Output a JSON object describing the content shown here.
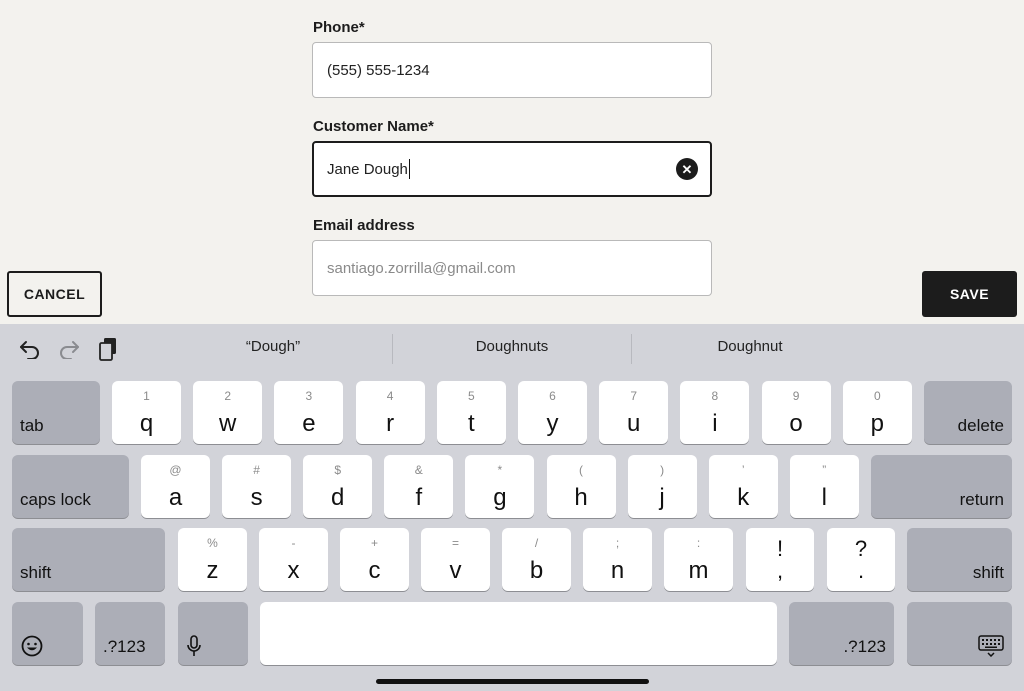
{
  "form": {
    "phone_label": "Phone*",
    "phone_value": "(555) 555-1234",
    "name_label": "Customer Name*",
    "name_value": "Jane Dough",
    "email_label": "Email address",
    "email_placeholder": "santiago.zorrilla@gmail.com"
  },
  "actions": {
    "cancel": "CANCEL",
    "save": "SAVE"
  },
  "keyboard": {
    "suggestions": [
      "“Dough”",
      "Doughnuts",
      "Doughnut"
    ],
    "toolbar_icons": [
      "undo-icon",
      "redo-icon",
      "clipboard-icon"
    ],
    "row1": [
      {
        "main": "q",
        "alt": "1"
      },
      {
        "main": "w",
        "alt": "2"
      },
      {
        "main": "e",
        "alt": "3"
      },
      {
        "main": "r",
        "alt": "4"
      },
      {
        "main": "t",
        "alt": "5"
      },
      {
        "main": "y",
        "alt": "6"
      },
      {
        "main": "u",
        "alt": "7"
      },
      {
        "main": "i",
        "alt": "8"
      },
      {
        "main": "o",
        "alt": "9"
      },
      {
        "main": "p",
        "alt": "0"
      }
    ],
    "row2": [
      {
        "main": "a",
        "alt": "@"
      },
      {
        "main": "s",
        "alt": "#"
      },
      {
        "main": "d",
        "alt": "$"
      },
      {
        "main": "f",
        "alt": "&"
      },
      {
        "main": "g",
        "alt": "*"
      },
      {
        "main": "h",
        "alt": "("
      },
      {
        "main": "j",
        "alt": ")"
      },
      {
        "main": "k",
        "alt": "’"
      },
      {
        "main": "l",
        "alt": "”"
      }
    ],
    "row3": [
      {
        "main": "z",
        "alt": "%"
      },
      {
        "main": "x",
        "alt": "-"
      },
      {
        "main": "c",
        "alt": "+"
      },
      {
        "main": "v",
        "alt": "="
      },
      {
        "main": "b",
        "alt": "/"
      },
      {
        "main": "n",
        "alt": ";"
      },
      {
        "main": "m",
        "alt": ":"
      }
    ],
    "punct": [
      {
        "top": "!",
        "bottom": ","
      },
      {
        "top": "?",
        "bottom": "."
      }
    ],
    "fn": {
      "tab": "tab",
      "delete": "delete",
      "caps_lock": "caps lock",
      "return": "return",
      "shift_left": "shift",
      "shift_right": "shift",
      "numbers_left": ".?123",
      "numbers_right": ".?123"
    }
  },
  "colors": {
    "background": "#f3f2ee",
    "keyboard": "#d2d3d9",
    "function_key": "#acaeb7",
    "primary": "#1c1c1c"
  }
}
